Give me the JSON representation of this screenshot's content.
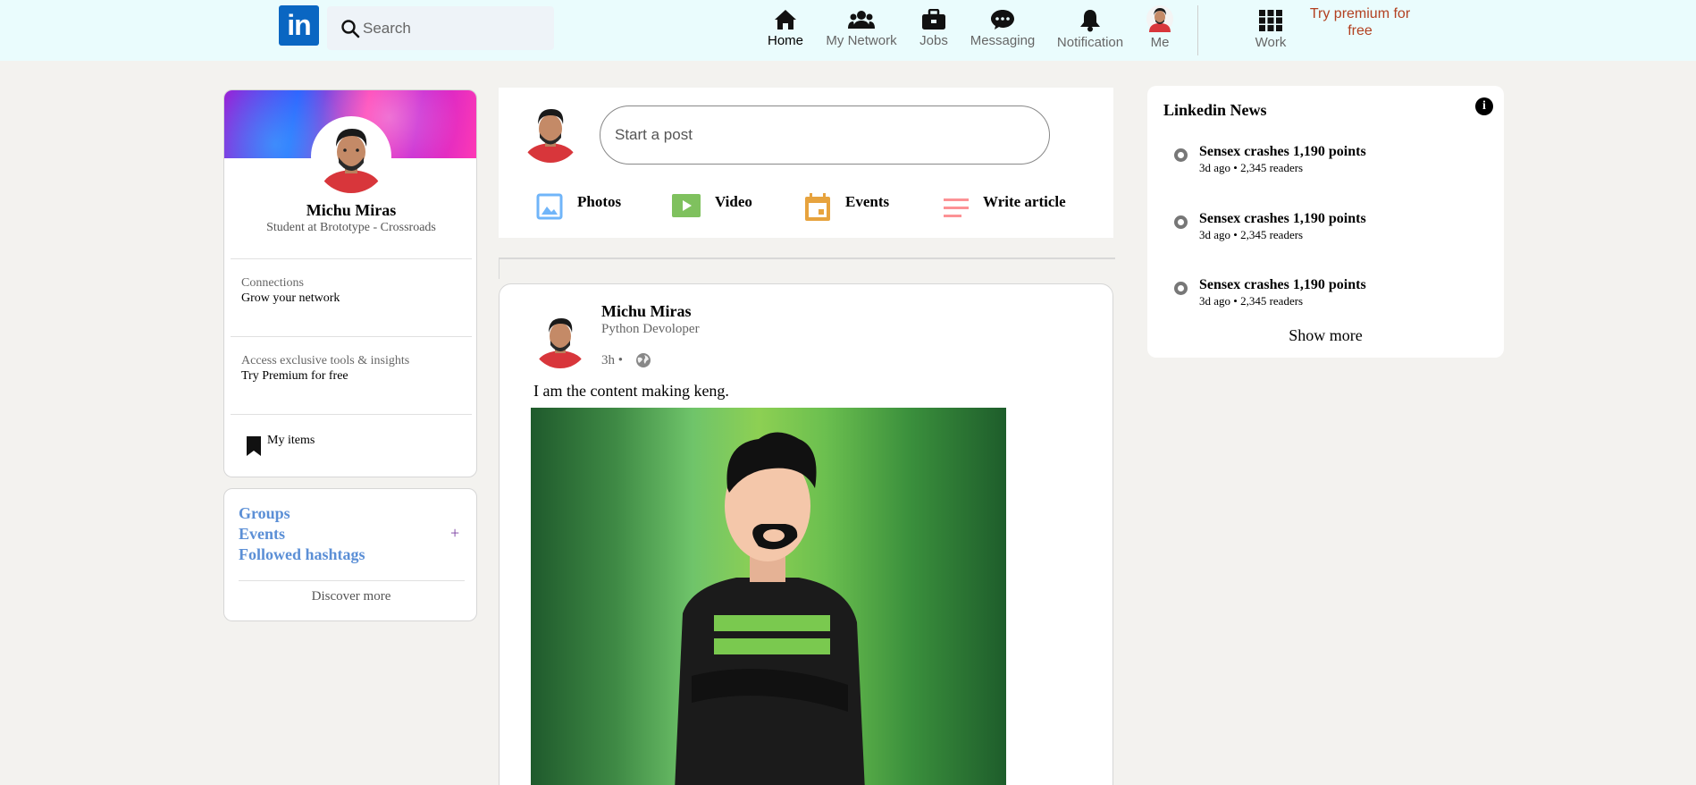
{
  "topbar": {
    "logo_text": "in",
    "search_placeholder": "Search",
    "nav": [
      {
        "label": "Home",
        "icon": "home-icon",
        "active": true
      },
      {
        "label": "My Network",
        "icon": "network-icon"
      },
      {
        "label": "Jobs",
        "icon": "briefcase-icon"
      },
      {
        "label": "Messaging",
        "icon": "message-icon"
      },
      {
        "label": "Notification",
        "icon": "bell-icon"
      },
      {
        "label": "Me",
        "icon": "avatar"
      },
      {
        "label": "Work",
        "icon": "grid-icon"
      }
    ],
    "premium_link": "Try premium for free"
  },
  "profile": {
    "name": "Michu Miras",
    "headline": "Student at Brototype - Crossroads",
    "connections_label": "Connections",
    "connections_value": "Grow your network",
    "premium_label": "Access exclusive tools & insights",
    "premium_value": "Try Premium for free",
    "my_items": "My items"
  },
  "groups": {
    "links": [
      "Groups",
      "Events",
      "Followed hashtags"
    ],
    "plus": "+",
    "discover": "Discover more"
  },
  "post_box": {
    "placeholder": "Start a post",
    "actions": [
      {
        "label": "Photos",
        "icon": "photo-icon",
        "color": "#70b5f9"
      },
      {
        "label": "Video",
        "icon": "video-icon",
        "color": "#7fc15e"
      },
      {
        "label": "Events",
        "icon": "calendar-icon",
        "color": "#e7a33e"
      },
      {
        "label": "Write article",
        "icon": "article-icon",
        "color": "#fc9295"
      }
    ]
  },
  "feed": {
    "post": {
      "author": "Michu Miras",
      "title": "Python Devoloper",
      "time": "3h •",
      "text": "I am the content making keng."
    }
  },
  "news": {
    "title": "Linkedin News",
    "info": "i",
    "items": [
      {
        "headline": "Sensex crashes 1,190 points",
        "meta": "3d ago • 2,345 readers"
      },
      {
        "headline": "Sensex crashes 1,190 points",
        "meta": "3d ago • 2,345 readers"
      },
      {
        "headline": "Sensex crashes 1,190 points",
        "meta": "3d ago • 2,345 readers"
      }
    ],
    "show_more": "Show more"
  },
  "colors": {
    "topbar_bg": "#eafcfd",
    "page_bg": "#f3f2ef",
    "brand": "#0a66c2",
    "premium_text": "#b24020",
    "group_link": "#5b8fd6"
  }
}
